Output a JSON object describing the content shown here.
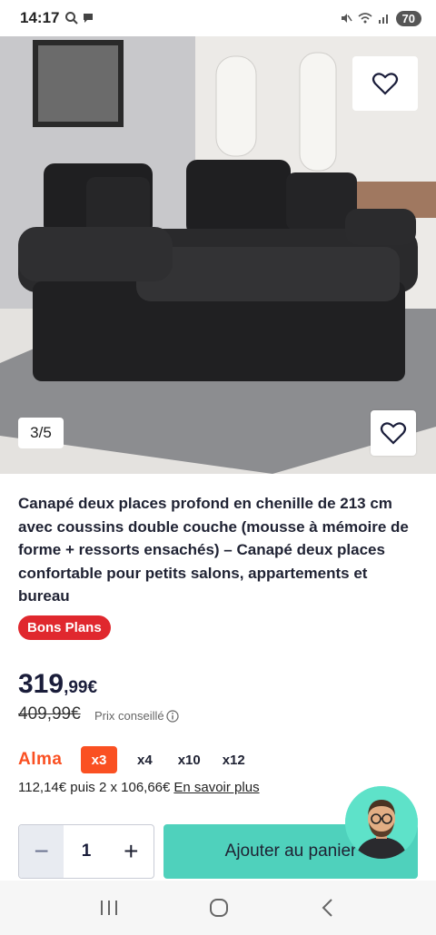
{
  "status": {
    "time": "14:17",
    "battery": "70"
  },
  "gallery": {
    "counter": "3/5"
  },
  "product": {
    "title": "Canapé deux places profond en chenille de 213 cm avec coussins double couche (mousse à mémoire de forme + ressorts ensachés) – Canapé deux places confortable pour petits salons, appartements et bureau",
    "badge": "Bons Plans",
    "price_int": "319",
    "price_dec": ",99€",
    "old_price": "409,99€",
    "rrp_label": "Prix conseillé"
  },
  "alma": {
    "logo": "Alma",
    "options": [
      "x3",
      "x4",
      "x10",
      "x12"
    ],
    "selected": "x3",
    "detail": "112,14€ puis 2 x 106,66€",
    "more_link": "En savoir plus"
  },
  "cart": {
    "quantity": "1",
    "minus": "−",
    "plus": "+",
    "add_label": "Ajouter au panier"
  },
  "colors": {
    "accent": "#4fd1bc",
    "alma": "#fa5022",
    "badge": "#e0282e",
    "text": "#1a1d3a"
  }
}
